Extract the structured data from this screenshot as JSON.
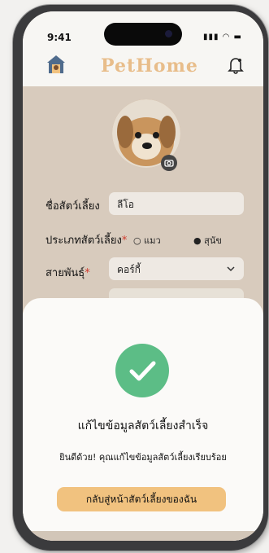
{
  "status_bar": {
    "time": "9:41",
    "icons": "signal-wifi-battery"
  },
  "header": {
    "brand": "PetHome",
    "logo_icon": "pet-house-icon",
    "notification_icon": "bell-icon"
  },
  "form": {
    "pet_name_label": "ชื่อสัตว์เลี้ยง",
    "pet_name_value": "ลีโอ",
    "pet_type_label": "ประเภทสัตว์เลี้ยง",
    "pet_type_options": [
      "แมว",
      "สุนัข"
    ],
    "pet_type_selected": "สุนัข",
    "breed_label": "สายพันธุ์",
    "breed_value": "คอร์กี้",
    "required_mark": "*"
  },
  "modal": {
    "title": "แก้ไขข้อมูลสัตว์เลี้ยงสำเร็จ",
    "message": "ยินดีด้วย! คุณแก้ไขข้อมูลสัตว์เลี้ยงเรียบร้อย",
    "button_label": "กลับสู่หน้าสัตว์เลี้ยงของฉัน",
    "success_color": "#5cbd86",
    "button_color": "#f1c27f"
  }
}
